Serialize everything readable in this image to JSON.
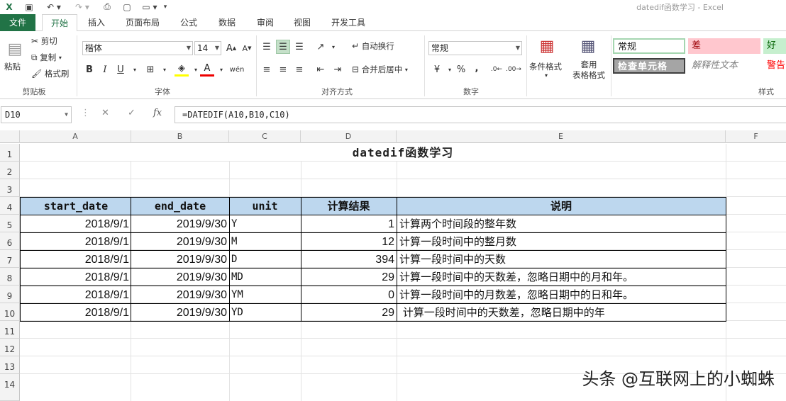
{
  "window": {
    "title": "datedif函数学习 - Excel"
  },
  "tabs": [
    {
      "label": "文件"
    },
    {
      "label": "开始"
    },
    {
      "label": "插入"
    },
    {
      "label": "页面布局"
    },
    {
      "label": "公式"
    },
    {
      "label": "数据"
    },
    {
      "label": "审阅"
    },
    {
      "label": "视图"
    },
    {
      "label": "开发工具"
    }
  ],
  "ribbon": {
    "clipboard": {
      "paste": "粘贴",
      "cut": "剪切",
      "copy": "复制",
      "format_painter": "格式刷",
      "label": "剪贴板"
    },
    "font": {
      "name": "楷体",
      "size": "14",
      "label": "字体",
      "bold": "B",
      "italic": "I",
      "underline": "U",
      "font_color": "A"
    },
    "alignment": {
      "wrap": "自动换行",
      "merge": "合并后居中",
      "label": "对齐方式"
    },
    "number": {
      "format": "常规",
      "label": "数字",
      "percent": "%",
      "comma": ","
    },
    "styles": {
      "conditional": "条件格式",
      "table_format": "套用\n表格格式",
      "normal": "常规",
      "bad": "差",
      "good": "好",
      "check_cell": "检查单元格",
      "explanatory": "解释性文本",
      "warning": "警告",
      "label": "样式"
    }
  },
  "formula_bar": {
    "name_box": "D10",
    "formula": "=DATEDIF(A10,B10,C10)",
    "fx": "fx"
  },
  "columns": [
    "A",
    "B",
    "C",
    "D",
    "E",
    "F"
  ],
  "rows": [
    "1",
    "2",
    "3",
    "4",
    "5",
    "6",
    "7",
    "8",
    "9",
    "10",
    "11",
    "12",
    "13",
    "14"
  ],
  "sheet": {
    "title": "datedif函数学习",
    "headers": [
      "start_date",
      "end_date",
      "unit",
      "计算结果",
      "说明"
    ],
    "data": [
      {
        "start": "2018/9/1",
        "end": "2019/9/30",
        "unit": "Y",
        "result": "1",
        "desc": "计算两个时间段的整年数"
      },
      {
        "start": "2018/9/1",
        "end": "2019/9/30",
        "unit": "M",
        "result": "12",
        "desc": "计算一段时间中的整月数"
      },
      {
        "start": "2018/9/1",
        "end": "2019/9/30",
        "unit": "D",
        "result": "394",
        "desc": "计算一段时间中的天数"
      },
      {
        "start": "2018/9/1",
        "end": "2019/9/30",
        "unit": "MD",
        "result": "29",
        "desc": "计算一段时间中的天数差，忽略日期中的月和年。"
      },
      {
        "start": "2018/9/1",
        "end": "2019/9/30",
        "unit": "YM",
        "result": "0",
        "desc": "计算一段时间中的月数差，忽略日期中的日和年。"
      },
      {
        "start": "2018/9/1",
        "end": "2019/9/30",
        "unit": "YD",
        "result": "29",
        "desc": " 计算一段时间中的天数差，忽略日期中的年"
      }
    ]
  },
  "watermark": "头条 @互联网上的小蜘蛛",
  "colors": {
    "excel_green": "#217346",
    "header_fill": "#bdd7ee",
    "bad_fill": "#ffc7ce",
    "good_fill": "#c6efce"
  }
}
